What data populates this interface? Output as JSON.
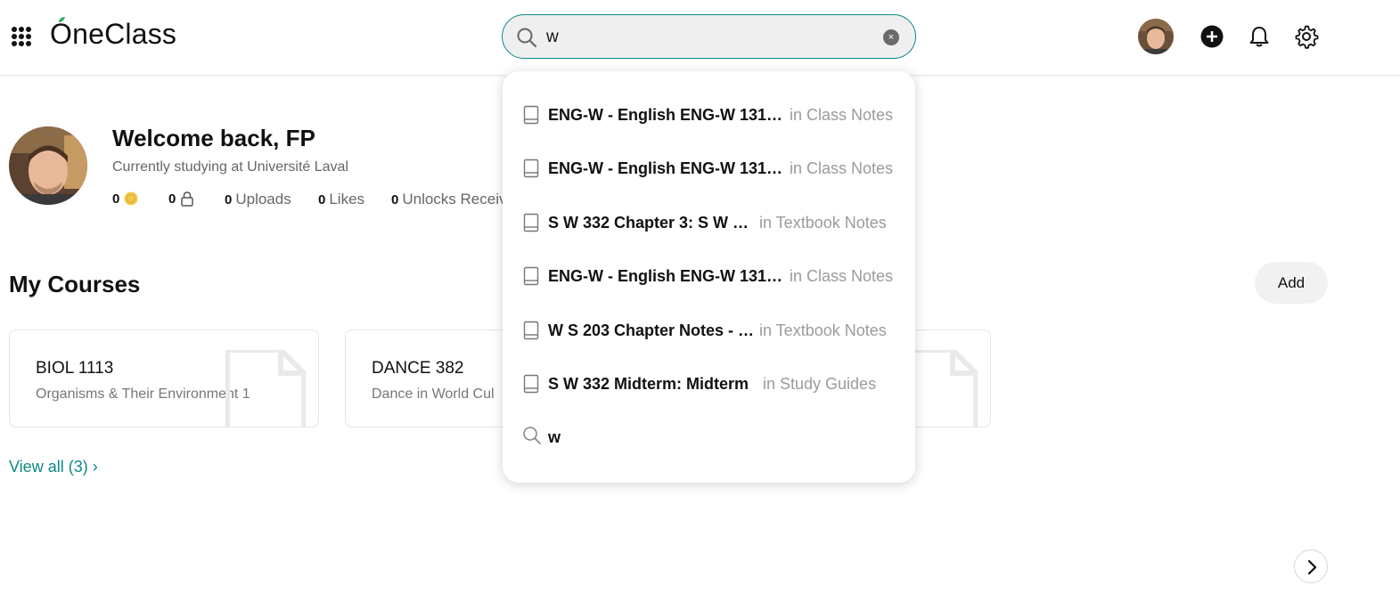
{
  "header": {
    "logo_text": "OneClass",
    "search_value": "w",
    "clear_label": "×"
  },
  "profile": {
    "welcome": "Welcome back, FP",
    "studying": "Currently studying at Université Laval",
    "stats": [
      {
        "value": "0",
        "label": "",
        "icon": "coin-icon"
      },
      {
        "value": "0",
        "label": "",
        "icon": "lock-icon"
      },
      {
        "value": "0",
        "label": "Uploads"
      },
      {
        "value": "0",
        "label": "Likes"
      },
      {
        "value": "0",
        "label": "Unlocks Receiv"
      }
    ]
  },
  "courses": {
    "heading": "My Courses",
    "add_label": "Add",
    "items": [
      {
        "code": "BIOL 1113",
        "name": "Organisms & Their Environment 1"
      },
      {
        "code": "DANCE 382",
        "name": "Dance in World Cul"
      }
    ],
    "view_all": "View all (3) ›"
  },
  "search_dropdown": {
    "items": [
      {
        "title": "ENG-W - English ENG-W 131…",
        "category": "in Class Notes"
      },
      {
        "title": "ENG-W - English ENG-W 131…",
        "category": "in Class Notes"
      },
      {
        "title": "S W 332 Chapter 3: S W …",
        "category": "in Textbook Notes"
      },
      {
        "title": "ENG-W - English ENG-W 131…",
        "category": "in Class Notes"
      },
      {
        "title": "W S 203 Chapter Notes - …",
        "category": "in Textbook Notes"
      },
      {
        "title": "S W 332 Midterm: Midterm",
        "category": "in Study Guides"
      }
    ],
    "search_query": "w"
  },
  "colors": {
    "accent": "#0b8a84",
    "muted_text": "#9b9b9b",
    "coin": "#f2c94c"
  }
}
